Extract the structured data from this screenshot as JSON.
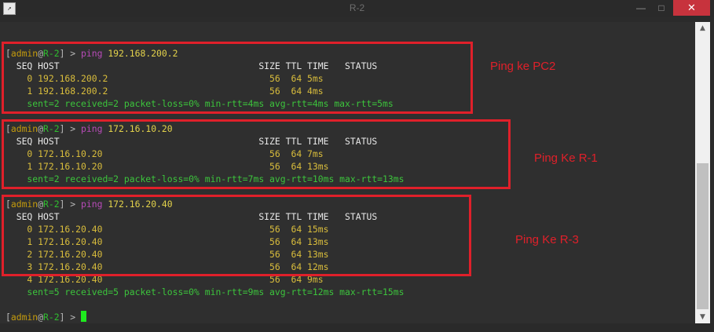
{
  "window": {
    "title": "R-2",
    "minimize_glyph": "—",
    "maximize_glyph": "□",
    "close_glyph": "✕",
    "icon_name": "terminal-app-icon"
  },
  "terminal": {
    "prompt": {
      "open": "[",
      "user": "admin",
      "at": "@",
      "host": "R-2",
      "close": "] >"
    },
    "header": "  SEQ HOST                                     SIZE TTL TIME   STATUS",
    "blocks": [
      {
        "command": "ping",
        "target": "192.168.200.2",
        "rows": [
          "    0 192.168.200.2                              56  64 5ms",
          "    1 192.168.200.2                              56  64 4ms"
        ],
        "stats": "    sent=2 received=2 packet-loss=0% min-rtt=4ms avg-rtt=4ms max-rtt=5ms"
      },
      {
        "command": "ping",
        "target": "172.16.10.20",
        "rows": [
          "    0 172.16.10.20                               56  64 7ms",
          "    1 172.16.10.20                               56  64 13ms"
        ],
        "stats": "    sent=2 received=2 packet-loss=0% min-rtt=7ms avg-rtt=10ms max-rtt=13ms"
      },
      {
        "command": "ping",
        "target": "172.16.20.40",
        "rows": [
          "    0 172.16.20.40                               56  64 15ms",
          "    1 172.16.20.40                               56  64 13ms",
          "    2 172.16.20.40                               56  64 13ms",
          "    3 172.16.20.40                               56  64 12ms",
          "    4 172.16.20.40                               56  64 9ms"
        ],
        "stats": "    sent=5 received=5 packet-loss=0% min-rtt=9ms avg-rtt=12ms max-rtt=15ms"
      }
    ]
  },
  "annotations": {
    "note1": "Ping ke PC2",
    "note2": "Ping Ke R-1",
    "note3": "Ping Ke R-3",
    "color": "#e0202a"
  },
  "scrollbar": {
    "up_glyph": "▲",
    "down_glyph": "▼"
  }
}
